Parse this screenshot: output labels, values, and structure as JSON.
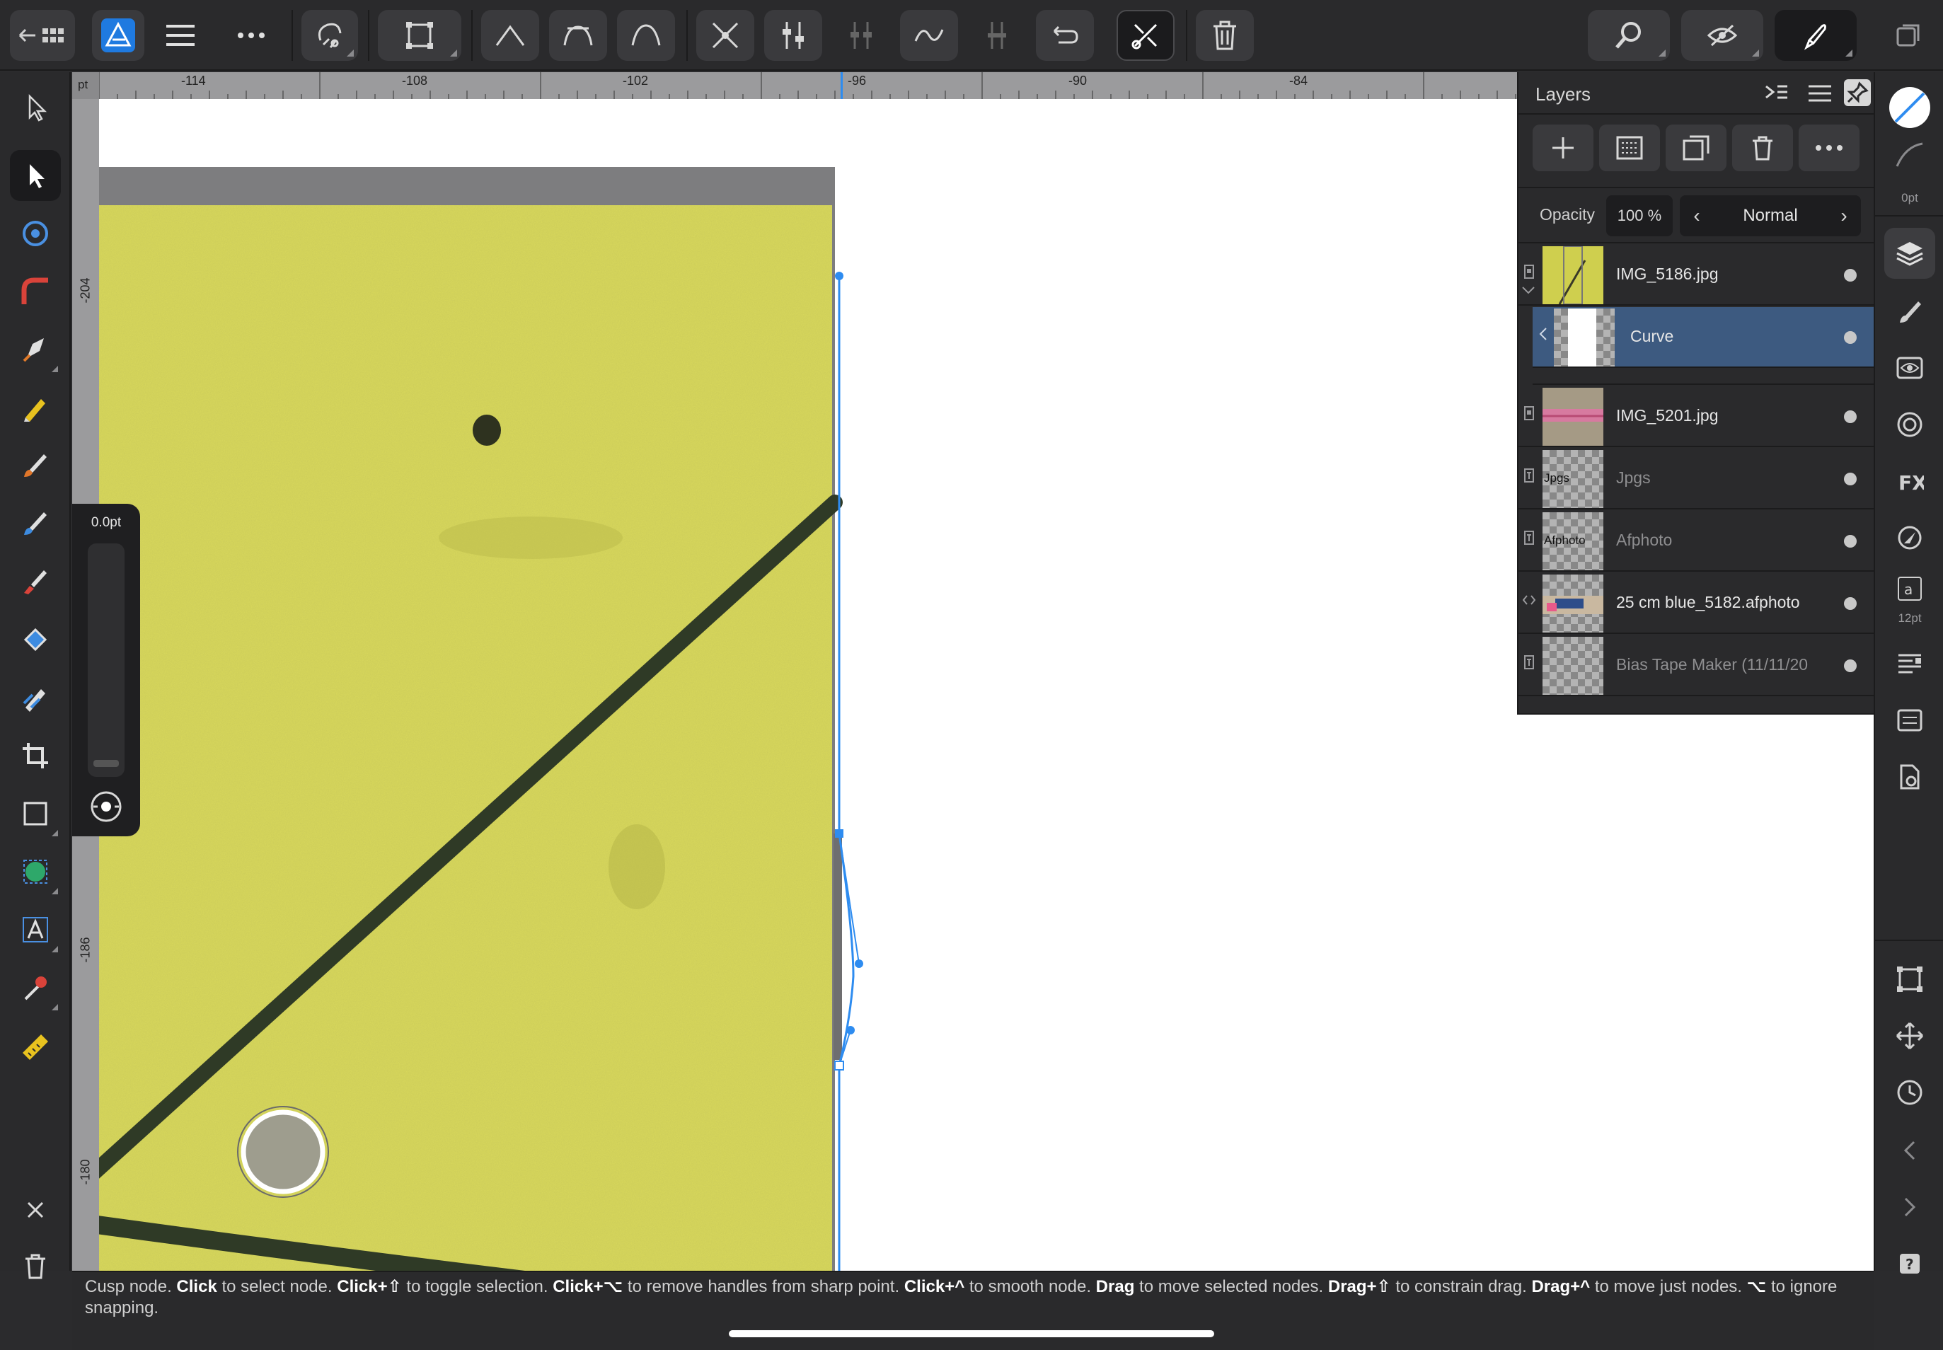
{
  "ruler": {
    "unit": "pt",
    "h_labels": [
      "-114",
      "-108",
      "-102",
      "-96",
      "-90",
      "-84"
    ],
    "v_labels": [
      "-204",
      "-186",
      "-180"
    ]
  },
  "brush_size": {
    "value": "0.0pt"
  },
  "layers_panel": {
    "title": "Layers",
    "opacity_label": "Opacity",
    "opacity_value": "100 %",
    "blend_mode": "Normal",
    "layers": [
      {
        "name": "IMG_5186.jpg",
        "type": "image",
        "selected": false,
        "dim": false
      },
      {
        "name": "Curve",
        "type": "curve",
        "selected": true,
        "dim": false
      },
      {
        "name": "IMG_5201.jpg",
        "type": "image",
        "selected": false,
        "dim": false
      },
      {
        "name": "Jpgs",
        "type": "text",
        "selected": false,
        "dim": true,
        "thumb_text": "Jpgs"
      },
      {
        "name": "Afphoto",
        "type": "text",
        "selected": false,
        "dim": true,
        "thumb_text": "Afphoto"
      },
      {
        "name": "25 cm blue_5182.afphoto",
        "type": "embedded",
        "selected": false,
        "dim": false
      },
      {
        "name": "Bias Tape Maker (11/11/20",
        "type": "text",
        "selected": false,
        "dim": true
      }
    ]
  },
  "right_toolbar": {
    "stroke_width_label": "0pt",
    "font_size_label": "12pt"
  },
  "colors": {
    "accent": "#2e8cf0",
    "selection": "#3d5a80",
    "paper": "#d9d95c",
    "line": "#2f3a26"
  },
  "status": {
    "segments": [
      {
        "text": "Cusp node. ",
        "bold": false
      },
      {
        "text": "Click",
        "bold": true
      },
      {
        "text": " to select node. ",
        "bold": false
      },
      {
        "text": "Click+⇧",
        "bold": true
      },
      {
        "text": " to toggle selection. ",
        "bold": false
      },
      {
        "text": "Click+⌥",
        "bold": true
      },
      {
        "text": " to remove handles from sharp point. ",
        "bold": false
      },
      {
        "text": "Click+^",
        "bold": true
      },
      {
        "text": " to smooth node. ",
        "bold": false
      },
      {
        "text": "Drag",
        "bold": true
      },
      {
        "text": " to move selected nodes. ",
        "bold": false
      },
      {
        "text": "Drag+⇧",
        "bold": true
      },
      {
        "text": " to constrain drag. ",
        "bold": false
      },
      {
        "text": "Drag+^",
        "bold": true
      },
      {
        "text": " to move just nodes. ",
        "bold": false
      },
      {
        "text": "⌥",
        "bold": true
      },
      {
        "text": " to ignore snapping.",
        "bold": false
      }
    ]
  }
}
